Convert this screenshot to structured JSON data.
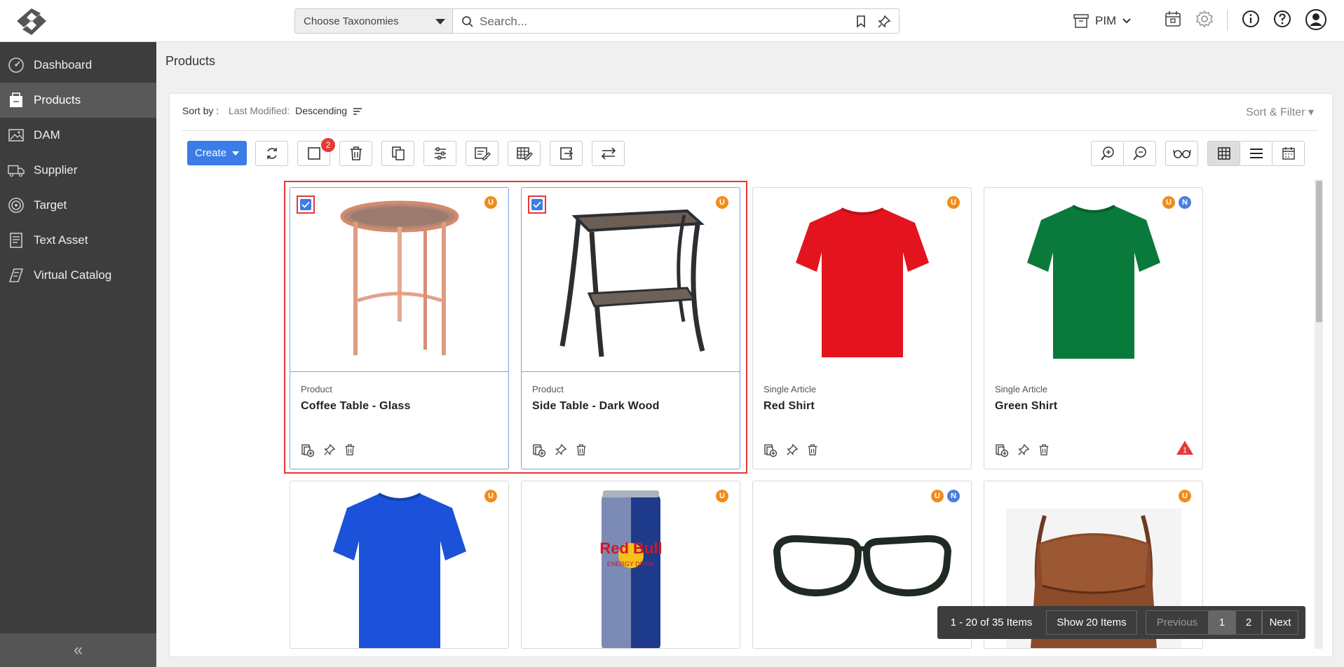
{
  "header": {
    "taxonomy_placeholder": "Choose Taxonomies",
    "search_placeholder": "Search...",
    "module": "PIM"
  },
  "sidebar": {
    "items": [
      {
        "label": "Dashboard",
        "icon": "dashboard-icon"
      },
      {
        "label": "Products",
        "icon": "products-icon"
      },
      {
        "label": "DAM",
        "icon": "image-icon"
      },
      {
        "label": "Supplier",
        "icon": "truck-icon"
      },
      {
        "label": "Target",
        "icon": "target-icon"
      },
      {
        "label": "Text Asset",
        "icon": "document-icon"
      },
      {
        "label": "Virtual Catalog",
        "icon": "catalog-icon"
      }
    ],
    "collapse_glyph": "«"
  },
  "page": {
    "title": "Products"
  },
  "sort": {
    "label": "Sort by :",
    "field": "Last Modified:",
    "direction": "Descending",
    "filter_label": "Sort & Filter ▾"
  },
  "toolbar": {
    "create_label": "Create",
    "selected_count": "2"
  },
  "cards": [
    {
      "type": "Product",
      "name": "Coffee Table - Glass",
      "badges": [
        "U"
      ],
      "selected": true
    },
    {
      "type": "Product",
      "name": "Side Table - Dark Wood",
      "badges": [
        "U"
      ],
      "selected": true
    },
    {
      "type": "Single Article",
      "name": "Red Shirt",
      "badges": [
        "U"
      ],
      "selected": false
    },
    {
      "type": "Single Article",
      "name": "Green Shirt",
      "badges": [
        "U",
        "N"
      ],
      "selected": false,
      "warning": "1"
    },
    {
      "badges": [
        "U"
      ]
    },
    {
      "badges": [
        "U"
      ],
      "image_text": "Red Bull",
      "image_subtext": "ENERGY DRINK"
    },
    {
      "badges": [
        "U",
        "N"
      ]
    },
    {
      "badges": [
        "U"
      ]
    }
  ],
  "pagination": {
    "range": "1 - 20 of 35 Items",
    "page_size": "Show 20 Items",
    "previous": "Previous",
    "pages": [
      "1",
      "2"
    ],
    "next": "Next"
  },
  "colors": {
    "accent": "#3b7ce6",
    "sidebar": "#3d3d3d",
    "selection": "#e53935",
    "badge_u": "#f08c1a",
    "badge_n": "#4a7fdc"
  }
}
